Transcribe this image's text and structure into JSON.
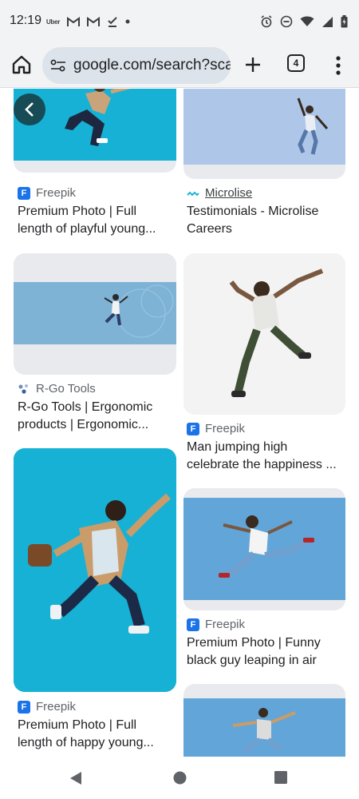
{
  "status_bar": {
    "time": "12:19",
    "uber_label": "Uber"
  },
  "toolbar": {
    "url": "google.com/search?sca_",
    "tab_count": "4"
  },
  "results": [
    {
      "source": "Freepik",
      "title_line1": "Premium Photo | Full",
      "title_line2": "length of playful young..."
    },
    {
      "source": "Microlise",
      "title_line1": "Testimonials - Microlise",
      "title_line2": "Careers"
    },
    {
      "source": "R-Go Tools",
      "title_line1": "R-Go Tools | Ergonomic",
      "title_line2": "products | Ergonomic..."
    },
    {
      "source": "Freepik",
      "title_line1": "Man jumping high",
      "title_line2": "celebrate the happiness ..."
    },
    {
      "source": "Freepik",
      "title_line1": "Premium Photo | Funny",
      "title_line2": "black guy leaping in air"
    },
    {
      "source": "Freepik",
      "title_line1": "Premium Photo | Full",
      "title_line2": "length of happy young..."
    }
  ],
  "favicon_letters": {
    "freepik": "F"
  },
  "colors": {
    "accent": "#1a73e8",
    "teal_bg": "#1cb6d6",
    "light_blue_bg": "#aec7e8",
    "sky_blue_bg": "#62a5d8"
  }
}
